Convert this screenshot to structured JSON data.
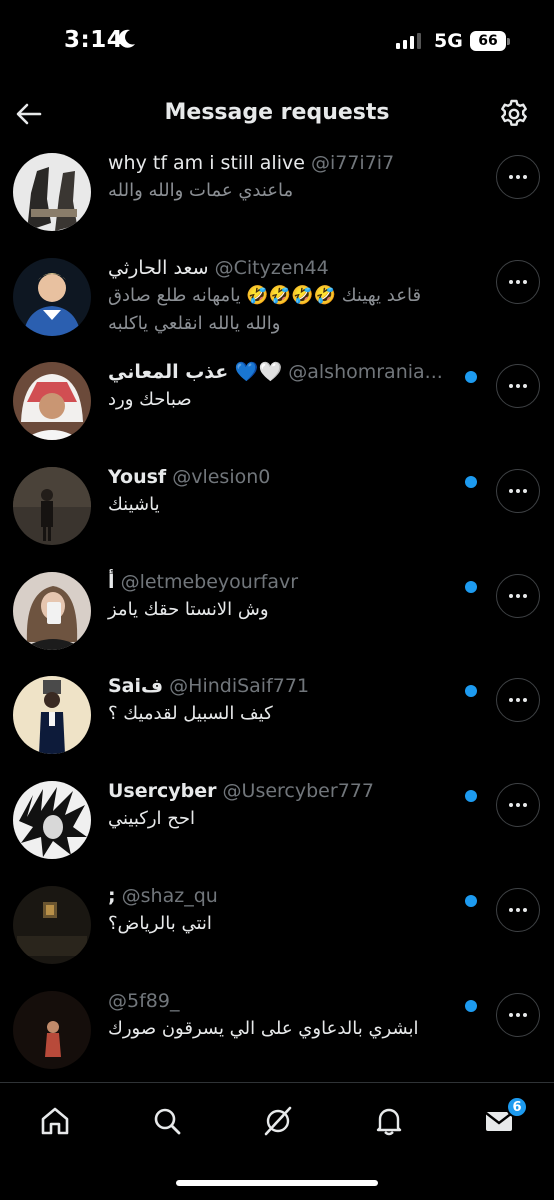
{
  "status": {
    "time": "3:14",
    "network": "5G",
    "battery": "66"
  },
  "header": {
    "title": "Message requests"
  },
  "requests": [
    {
      "name": "why tf am i still alive",
      "handle": "@i77i7i7",
      "message": "ماعندي عمات والله والله",
      "unread": false,
      "dim": true
    },
    {
      "name": "سعد الحارثي",
      "handle": "@Cityzen44",
      "message": "قاعد يهينك 🤣🤣🤣🤣 يامهانه طلع صادق والله يالله انقلعي ياكلبه",
      "unread": false,
      "dim": true
    },
    {
      "name": "عذب المعاني 💙🤍",
      "handle": "@alshomrania...",
      "message": "صباحك  ورد",
      "unread": true,
      "dim": false
    },
    {
      "name": "Yousf",
      "handle": "@vlesion0",
      "message": "ياشينك",
      "unread": true,
      "dim": false
    },
    {
      "name": "أ",
      "handle": "@letmebeyourfavr",
      "message": "وش الانستا حقك يامز",
      "unread": true,
      "dim": false
    },
    {
      "name": "Saiف",
      "handle": "@HindiSaif771",
      "message": "كيف السبيل لقدميك ؟",
      "unread": true,
      "dim": false
    },
    {
      "name": "Usercyber",
      "handle": "@Usercyber777",
      "message": "احح اركبيني",
      "unread": true,
      "dim": false
    },
    {
      "name": ";",
      "handle": "@shaz_qu",
      "message": "انتي بالرياض؟",
      "unread": true,
      "dim": false
    },
    {
      "name": "",
      "handle": "@5f89_",
      "message": "ابشري بالدعاوي على الي يسرقون صورك",
      "unread": true,
      "dim": false
    }
  ],
  "tabs": {
    "messages_badge": "6"
  },
  "colors": {
    "accent": "#1d9bf0",
    "background": "#000000",
    "secondary_text": "#71767b"
  },
  "icons": {
    "back": "arrow-left-icon",
    "settings": "gear-icon",
    "more": "more-horizontal-icon",
    "home": "home-icon",
    "search": "search-icon",
    "grok": "grok-icon",
    "notifications": "bell-icon",
    "messages": "envelope-icon"
  }
}
